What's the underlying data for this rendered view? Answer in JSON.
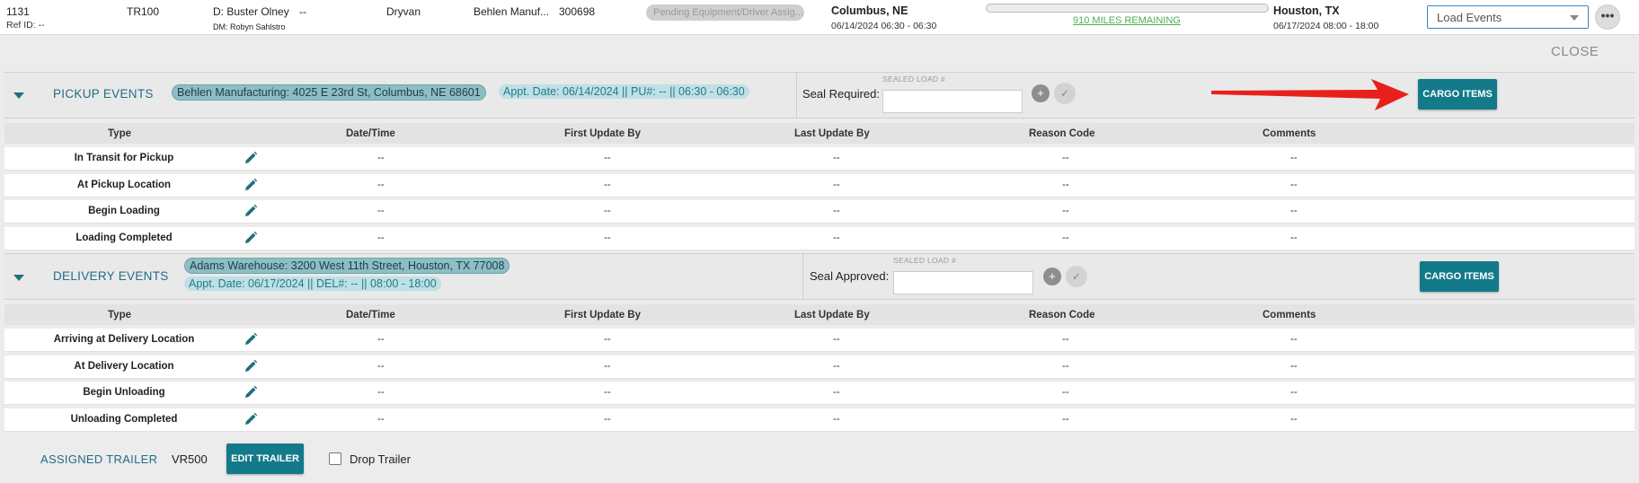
{
  "header": {
    "load_number": "1131",
    "ref_id": "Ref ID: --",
    "tractor": "TR100",
    "driver": "D: Buster Olney",
    "driver_extra": "--",
    "dispatcher": "DM: Robyn Sahlstro",
    "trailer_type": "Dryvan",
    "customer": "Behlen Manuf...",
    "order_number": "300698",
    "status": "Pending Equipment/Driver Assig...",
    "origin_city": "Columbus, NE",
    "origin_window": "06/14/2024 06:30 - 06:30",
    "miles_remaining": "910 MILES REMAINING",
    "progress_percent": 0,
    "dest_city": "Houston, TX",
    "dest_window": "06/17/2024 08:00 - 18:00",
    "view_select_value": "Load Events",
    "more_label": "•••",
    "close_label": "CLOSE"
  },
  "pickup": {
    "title": "PICKUP EVENTS",
    "address": "Behlen Manufacturing: 4025 E 23rd St, Columbus, NE 68601",
    "appt": "Appt. Date: 06/14/2024 || PU#: -- || 06:30 - 06:30",
    "seal_label": "Seal Required:",
    "sealed_load_label": "SEALED LOAD #",
    "cargo_button": "CARGO ITEMS",
    "columns": [
      "Type",
      "Date/Time",
      "First Update By",
      "Last Update By",
      "Reason Code",
      "Comments"
    ],
    "rows": [
      {
        "type": "In Transit for Pickup",
        "datetime": "--",
        "first": "--",
        "last": "--",
        "reason": "--",
        "comments": "--"
      },
      {
        "type": "At Pickup Location",
        "datetime": "--",
        "first": "--",
        "last": "--",
        "reason": "--",
        "comments": "--"
      },
      {
        "type": "Begin Loading",
        "datetime": "--",
        "first": "--",
        "last": "--",
        "reason": "--",
        "comments": "--"
      },
      {
        "type": "Loading Completed",
        "datetime": "--",
        "first": "--",
        "last": "--",
        "reason": "--",
        "comments": "--"
      }
    ]
  },
  "delivery": {
    "title": "DELIVERY EVENTS",
    "address": "Adams Warehouse: 3200 West 11th Street, Houston, TX 77008",
    "appt": "Appt. Date: 06/17/2024 || DEL#: -- || 08:00 - 18:00",
    "seal_label": "Seal Approved:",
    "sealed_load_label": "SEALED LOAD #",
    "cargo_button": "CARGO ITEMS",
    "columns": [
      "Type",
      "Date/Time",
      "First Update By",
      "Last Update By",
      "Reason Code",
      "Comments"
    ],
    "rows": [
      {
        "type": "Arriving at Delivery Location",
        "datetime": "--",
        "first": "--",
        "last": "--",
        "reason": "--",
        "comments": "--"
      },
      {
        "type": "At Delivery Location",
        "datetime": "--",
        "first": "--",
        "last": "--",
        "reason": "--",
        "comments": "--"
      },
      {
        "type": "Begin Unloading",
        "datetime": "--",
        "first": "--",
        "last": "--",
        "reason": "--",
        "comments": "--"
      },
      {
        "type": "Unloading Completed",
        "datetime": "--",
        "first": "--",
        "last": "--",
        "reason": "--",
        "comments": "--"
      }
    ]
  },
  "footer": {
    "assigned_trailer_label": "ASSIGNED TRAILER",
    "trailer_id": "VR500",
    "edit_trailer_button": "EDIT TRAILER",
    "drop_trailer_label": "Drop Trailer"
  },
  "colors": {
    "teal": "#137a8a",
    "section_title": "#1f6d86",
    "arrow": "#e8201c"
  },
  "icons": [
    "pencil-icon",
    "plus-circle-icon",
    "check-circle-icon",
    "chevron-down-icon",
    "red-arrow-annotation"
  ]
}
